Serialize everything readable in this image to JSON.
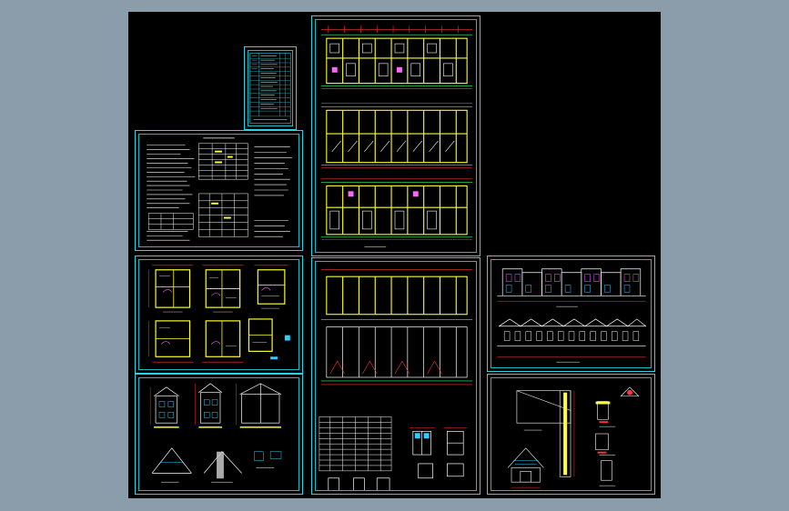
{
  "window": {
    "title": "",
    "background": "#8b9dab",
    "model_space_color": "#000000"
  },
  "colors": {
    "frame": "#2fd3e0",
    "wall": "#ffff33",
    "dim": "#ff3333",
    "axis": "#33ff66",
    "line": "#ffffff",
    "room": "#ff66ff",
    "accent": "#33ccff"
  },
  "sheets": [
    {
      "id": "drawing-index",
      "kind": "title-block-table"
    },
    {
      "id": "design-notes",
      "kind": "notes-and-schedule"
    },
    {
      "id": "typical-unit-plans",
      "kind": "unit-plans"
    },
    {
      "id": "unit-elevations-sections",
      "kind": "elevations-and-sections"
    },
    {
      "id": "floor-plans-1-3",
      "kind": "row-house-floor-plans"
    },
    {
      "id": "roof-plan-door-window-schedule",
      "kind": "plan-and-schedule"
    },
    {
      "id": "row-elevations",
      "kind": "street-elevations"
    },
    {
      "id": "wall-details",
      "kind": "construction-details"
    }
  ]
}
